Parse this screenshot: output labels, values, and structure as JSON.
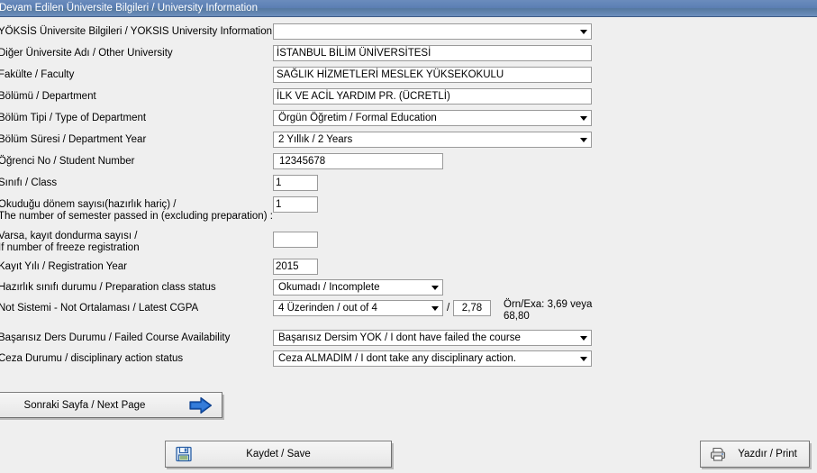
{
  "window": {
    "title": "Devam Edilen Üniversite Bilgileri / University Information",
    "title_bar_color": "#5b7fb4",
    "background_color": "#efefef"
  },
  "form": {
    "fields": [
      {
        "key": "yoksis_university",
        "label": "YÖKSİS Üniversite Bilgileri / YOKSIS University Information",
        "type": "select",
        "value": ""
      },
      {
        "key": "other_university",
        "label": "Diğer Üniversite Adı / Other University",
        "type": "input",
        "value": "İSTANBUL BİLİM ÜNİVERSİTESİ"
      },
      {
        "key": "faculty",
        "label": "Fakülte / Faculty",
        "type": "input",
        "value": "SAĞLIK HİZMETLERİ MESLEK YÜKSEKOKULU"
      },
      {
        "key": "department",
        "label": "Bölümü / Department",
        "type": "input",
        "value": "İLK VE ACİL YARDIM PR. (ÜCRETLİ)"
      },
      {
        "key": "department_type",
        "label": "Bölüm Tipi / Type of Department",
        "type": "select",
        "value": "Örgün Öğretim / Formal Education"
      },
      {
        "key": "department_year",
        "label": "Bölüm Süresi / Department Year",
        "type": "select",
        "value": "2 Yıllık / 2 Years"
      },
      {
        "key": "student_number",
        "label": "Öğrenci No / Student Number",
        "type": "input",
        "value": "12345678"
      },
      {
        "key": "class",
        "label": "Sınıfı / Class",
        "type": "input",
        "value": "1"
      },
      {
        "key": "semesters_passed",
        "label": "Okuduğu dönem sayısı(hazırlık hariç) /\nThe number of semester passed in (excluding preparation) :",
        "type": "input",
        "value": "1"
      },
      {
        "key": "freeze_registration",
        "label": "Varsa, kayıt dondurma sayısı /\nIf number of freeze registration",
        "type": "input",
        "value": ""
      },
      {
        "key": "registration_year",
        "label": "Kayıt Yılı / Registration Year",
        "type": "input",
        "value": "2015"
      },
      {
        "key": "preparation_class",
        "label": "Hazırlık sınıfı durumu / Preparation class status",
        "type": "select",
        "value": "Okumadı / Incomplete"
      },
      {
        "key": "cgpa_system",
        "label": "Not Sistemi - Not Ortalaması / Latest CGPA",
        "type": "select",
        "value": "4 Üzerinden / out of 4"
      },
      {
        "key": "failed_course",
        "label": "Başarısız Ders Durumu / Failed Course Availability",
        "type": "select",
        "value": "Başarısız Dersim YOK / I dont have failed the course"
      },
      {
        "key": "disciplinary_action",
        "label": "Ceza Durumu / disciplinary action status",
        "type": "select",
        "value": "Ceza ALMADIM / I dont take any disciplinary action."
      }
    ],
    "cgpa": {
      "separator": "/",
      "value": "2,78",
      "hint": "Örn/Exa: 3,69 veya 68,80"
    }
  },
  "buttons": {
    "next_page": {
      "label": "Sonraki Sayfa / Next Page",
      "icon": "arrow-right-icon"
    },
    "save": {
      "label": "Kaydet / Save",
      "icon": "floppy-disk-icon"
    },
    "print": {
      "label": "Yazdır / Print",
      "icon": "printer-icon"
    }
  }
}
